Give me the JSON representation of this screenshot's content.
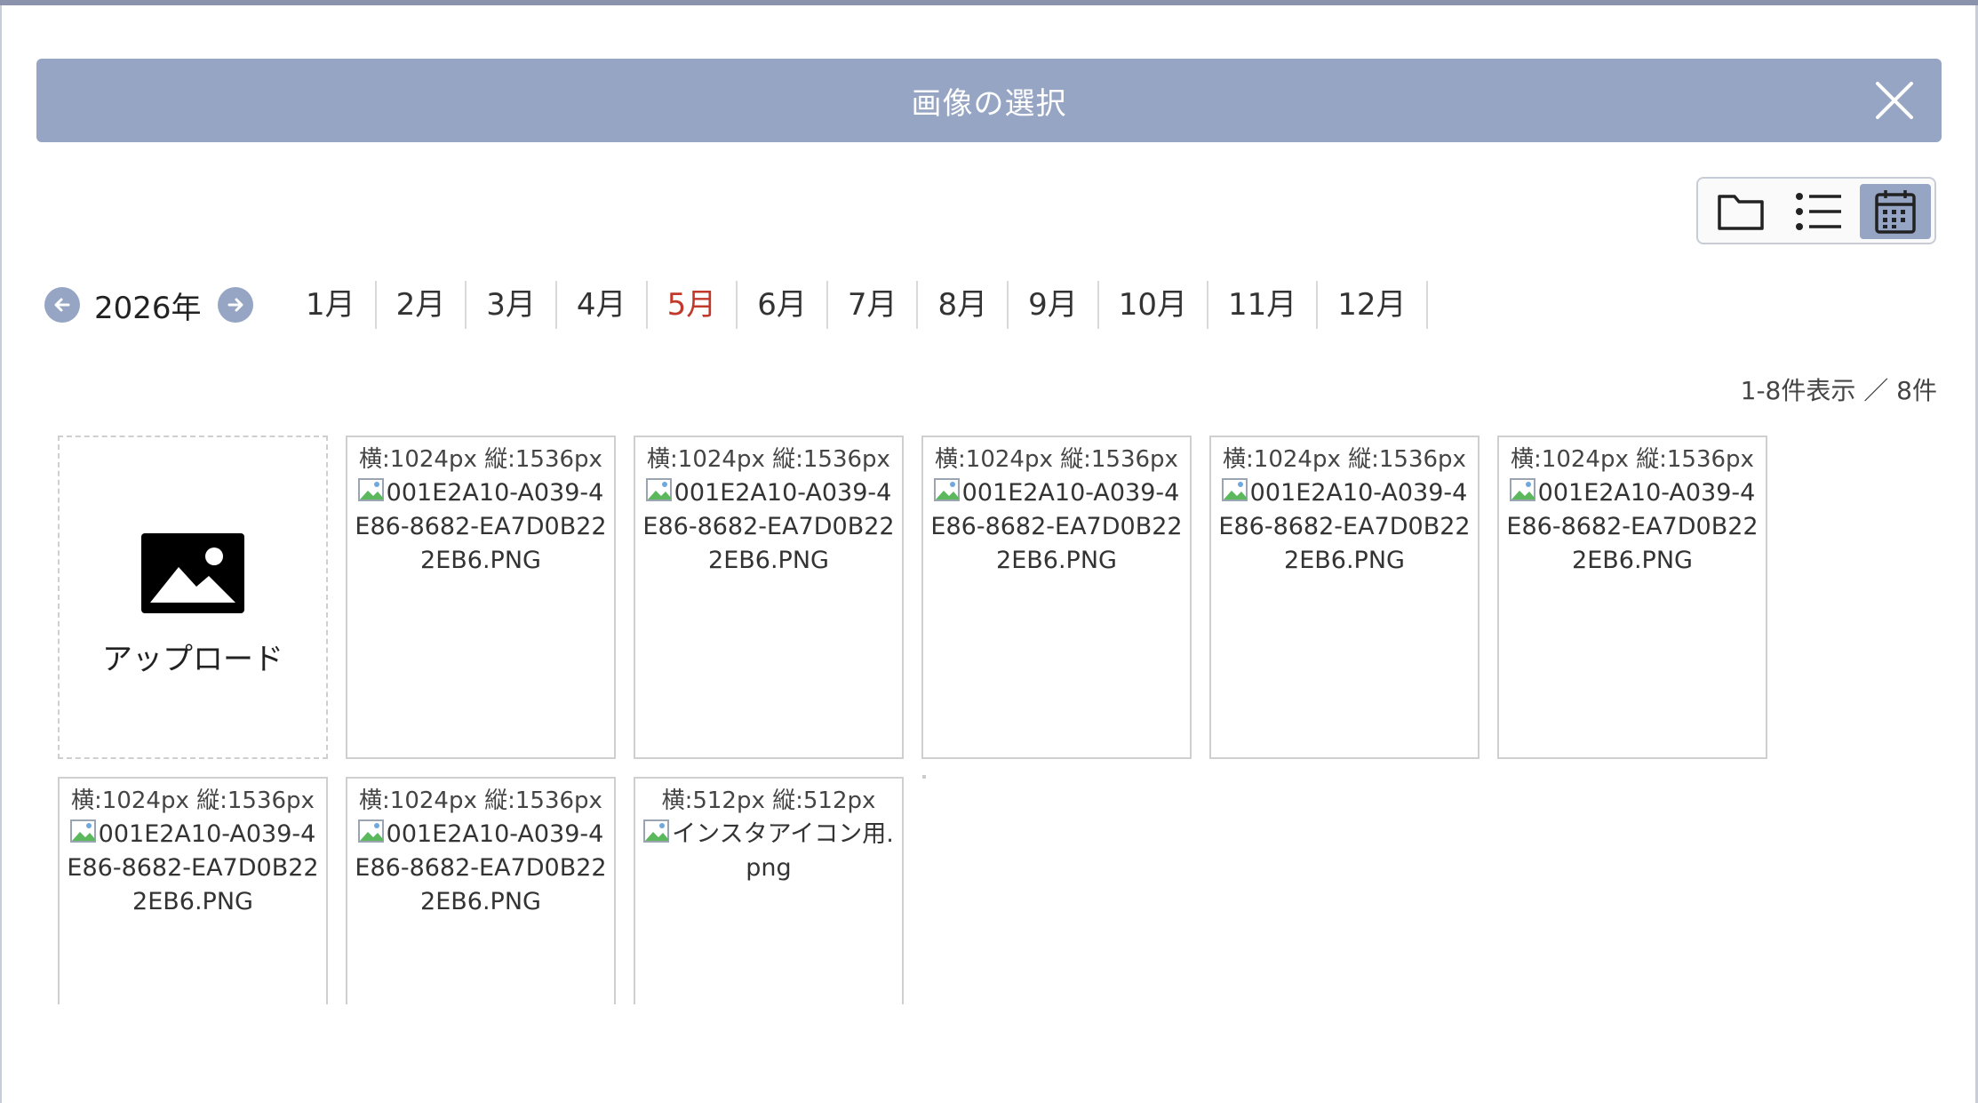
{
  "dialog": {
    "title": "画像の選択"
  },
  "calendar": {
    "year": "2026年",
    "months": [
      {
        "label": "1月",
        "active": false
      },
      {
        "label": "2月",
        "active": false
      },
      {
        "label": "3月",
        "active": false
      },
      {
        "label": "4月",
        "active": false
      },
      {
        "label": "5月",
        "active": true
      },
      {
        "label": "6月",
        "active": false
      },
      {
        "label": "7月",
        "active": false
      },
      {
        "label": "8月",
        "active": false
      },
      {
        "label": "9月",
        "active": false
      },
      {
        "label": "10月",
        "active": false
      },
      {
        "label": "11月",
        "active": false
      },
      {
        "label": "12月",
        "active": false
      }
    ]
  },
  "view_toggle": {
    "options": [
      "folder-icon",
      "list-icon",
      "calendar-icon"
    ],
    "active": "calendar-icon"
  },
  "result_count": "1-8件表示 ／ 8件",
  "upload": {
    "label": "アップロード",
    "icon": "image-icon"
  },
  "images": [
    {
      "size": "横:1024px 縦:1536px",
      "filename": "001E2A10-A039-4E86-8682-EA7D0B222EB6.PNG"
    },
    {
      "size": "横:1024px 縦:1536px",
      "filename": "001E2A10-A039-4E86-8682-EA7D0B222EB6.PNG"
    },
    {
      "size": "横:1024px 縦:1536px",
      "filename": "001E2A10-A039-4E86-8682-EA7D0B222EB6.PNG"
    },
    {
      "size": "横:1024px 縦:1536px",
      "filename": "001E2A10-A039-4E86-8682-EA7D0B222EB6.PNG"
    },
    {
      "size": "横:1024px 縦:1536px",
      "filename": "001E2A10-A039-4E86-8682-EA7D0B222EB6.PNG"
    },
    {
      "size": "横:1024px 縦:1536px",
      "filename": "001E2A10-A039-4E86-8682-EA7D0B222EB6.PNG"
    },
    {
      "size": "横:1024px 縦:1536px",
      "filename": "001E2A10-A039-4E86-8682-EA7D0B222EB6.PNG"
    },
    {
      "size": "横:512px 縦:512px",
      "filename": "インスタアイコン用.png"
    }
  ],
  "colors": {
    "header_bg": "#95a5c3",
    "active_month": "#c0392b",
    "active_view_bg": "#95a5c3"
  }
}
